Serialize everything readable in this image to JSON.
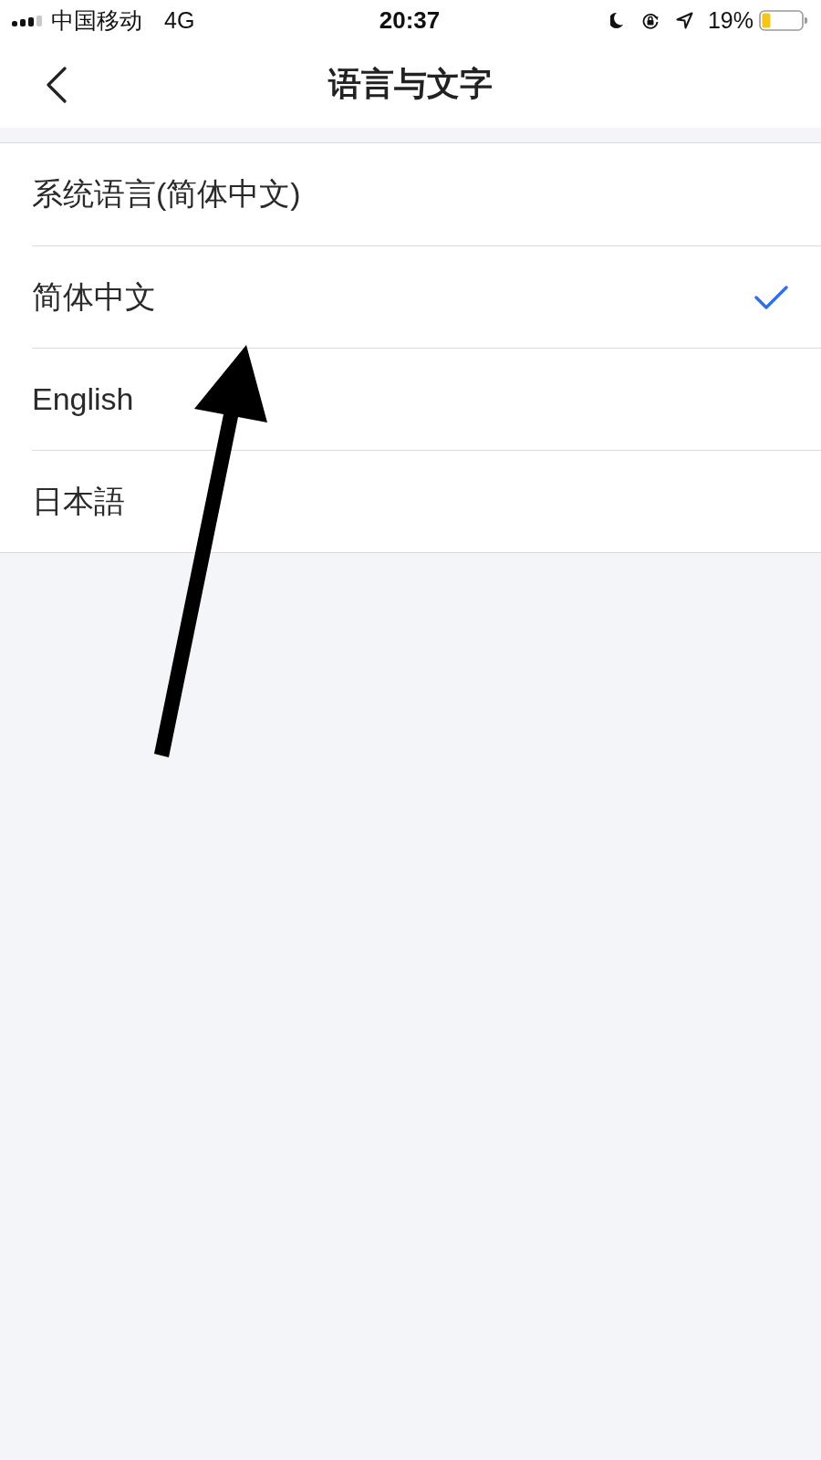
{
  "status_bar": {
    "carrier": "中国移动",
    "network": "4G",
    "time": "20:37",
    "battery_percent": "19%"
  },
  "nav_bar": {
    "title": "语言与文字"
  },
  "languages": [
    {
      "label": "系统语言(简体中文)",
      "selected": false
    },
    {
      "label": "简体中文",
      "selected": true
    },
    {
      "label": "English",
      "selected": false
    },
    {
      "label": "日本語",
      "selected": false
    }
  ]
}
